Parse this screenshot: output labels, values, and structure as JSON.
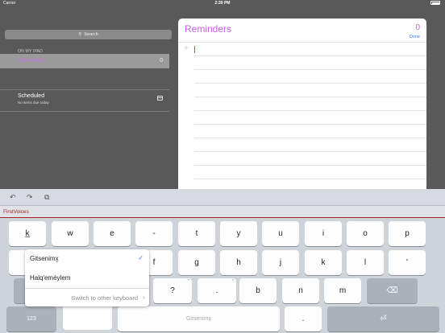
{
  "status_bar": {
    "carrier": "Carrier",
    "time": "2:39 PM"
  },
  "sidebar": {
    "search_label": "Search",
    "section_title": "ON MY IPAD",
    "selected_list": {
      "label": "Reminders",
      "count": "0"
    },
    "scheduled": {
      "label": "Scheduled",
      "sub": "No items due today"
    }
  },
  "panel": {
    "title": "Reminders",
    "count": "0",
    "done_label": "Done"
  },
  "toolbar": {
    "undo": "↶",
    "redo": "↷",
    "paste": "⧉"
  },
  "keyboard": {
    "brand": "FirstVoices",
    "row1": [
      {
        "label": "k̲",
        "hint": ""
      },
      {
        "label": "w",
        "hint": ""
      },
      {
        "label": "e",
        "hint": ""
      },
      {
        "label": "-",
        "hint": ""
      },
      {
        "label": "t",
        "hint": ""
      },
      {
        "label": "y",
        "hint": ""
      },
      {
        "label": "u",
        "hint": ""
      },
      {
        "label": "i",
        "hint": ""
      },
      {
        "label": "o",
        "hint": ""
      },
      {
        "label": "p",
        "hint": ""
      }
    ],
    "row2": [
      {
        "label": "f",
        "hint": ""
      },
      {
        "label": "g",
        "hint": ""
      },
      {
        "label": "h",
        "hint": ""
      },
      {
        "label": "j",
        "hint": ""
      },
      {
        "label": "k",
        "hint": ""
      },
      {
        "label": "l",
        "hint": ""
      },
      {
        "label": "'",
        "hint": ""
      }
    ],
    "row3": [
      {
        "label": "?",
        "hint": "\""
      },
      {
        "label": ".",
        "hint": "\""
      },
      {
        "label": "b",
        "hint": ""
      },
      {
        "label": "n",
        "hint": ""
      },
      {
        "label": "m",
        "hint": ""
      }
    ],
    "delete_icon": "⌫",
    "num_label": "123",
    "space_label": "Gitsenimx̱",
    "dot_label": ".",
    "return_icon": "⏎"
  },
  "popup": {
    "items": [
      "Gitsenimx̱",
      "Halq'eméylem"
    ],
    "selected_check": "✓",
    "switch_label": "Switch to other keyboard",
    "switch_chevron": "›"
  }
}
